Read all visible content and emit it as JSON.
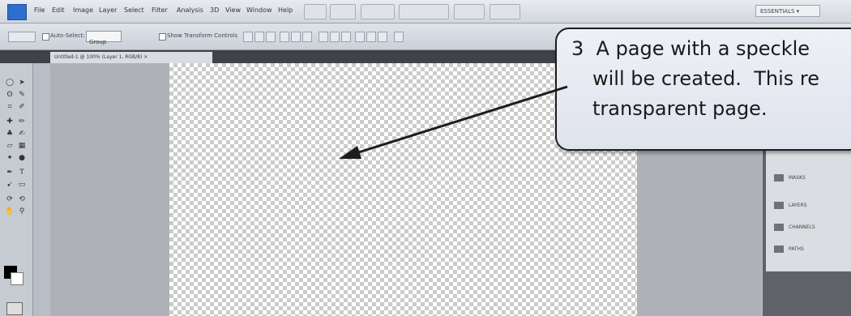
{
  "menubar": {
    "items": [
      "File",
      "Edit",
      "Image",
      "Layer",
      "Select",
      "Filter",
      "Analysis",
      "3D",
      "View",
      "Window",
      "Help"
    ],
    "workspace": "ESSENTIALS ▾"
  },
  "options": {
    "auto_select_label": "Auto-Select:",
    "auto_select_value": "Group",
    "show_transform_label": "Show Transform Controls"
  },
  "document": {
    "tab_label": "Untitled-1 @ 100% (Layer 1, RGB/8) ×"
  },
  "panels": {
    "items": [
      "MASKS",
      "LAYERS",
      "CHANNELS",
      "PATHS"
    ]
  },
  "callout": {
    "line1": "3  A page with a speckle",
    "line2": "will be created.  This re",
    "line3": "transparent page."
  },
  "colors": {
    "callout_border": "#1d1d1d",
    "arrow": "#1d1d1d",
    "checker": "#cbcbcb"
  }
}
